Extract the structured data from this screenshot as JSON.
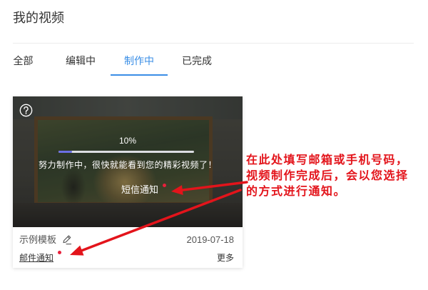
{
  "header": {
    "title": "我的视频"
  },
  "tabs": [
    {
      "label": "全部",
      "active": false
    },
    {
      "label": "编辑中",
      "active": false
    },
    {
      "label": "制作中",
      "active": true
    },
    {
      "label": "已完成",
      "active": false
    }
  ],
  "colors": {
    "accent": "#3a8ee6",
    "annotation": "#e3141b",
    "notify_dot": "#e8203b",
    "progress_fill": "#6b6fe4"
  },
  "icons": {
    "help": "question-circle-icon",
    "edit": "pencil-icon"
  },
  "video_card": {
    "progress": {
      "percent_label": "10%",
      "value": 0.1
    },
    "status_message": "努力制作中，很快就能看到您的精彩视频了！",
    "sms_notify_label": "短信通知",
    "template_name": "示例模板",
    "date": "2019-07-18",
    "email_notify_label": "邮件通知",
    "more_label": "更多"
  },
  "annotation": {
    "lines": [
      "在此处填写邮箱或手机号码，",
      "视频制作完成后，会以您选择",
      "的方式进行通知。"
    ]
  }
}
